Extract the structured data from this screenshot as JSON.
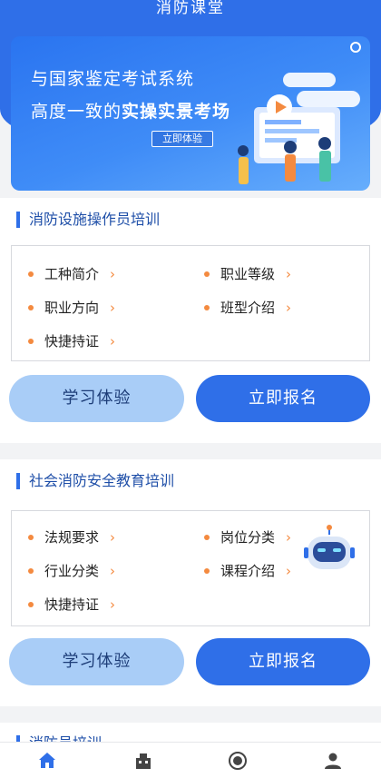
{
  "header": {
    "title": "消防课堂"
  },
  "banner": {
    "line1": "与国家鉴定考试系统",
    "line2_prefix": "高度一致的",
    "line2_bold": "实操实景考场",
    "cta": "立即体验"
  },
  "sections": [
    {
      "title": "消防设施操作员培训",
      "items": [
        {
          "label": "工种简介"
        },
        {
          "label": "职业等级"
        },
        {
          "label": "职业方向"
        },
        {
          "label": "班型介绍"
        },
        {
          "label": "快捷持证"
        }
      ],
      "btn_exp": "学习体验",
      "btn_reg": "立即报名"
    },
    {
      "title": "社会消防安全教育培训",
      "items": [
        {
          "label": "法规要求"
        },
        {
          "label": "岗位分类"
        },
        {
          "label": "行业分类"
        },
        {
          "label": "课程介绍"
        },
        {
          "label": "快捷持证"
        }
      ],
      "btn_exp": "学习体验",
      "btn_reg": "立即报名"
    },
    {
      "title": "消防员培训"
    }
  ],
  "tabbar": [
    {
      "icon": "home-icon"
    },
    {
      "icon": "building-icon"
    },
    {
      "icon": "coin-icon"
    },
    {
      "icon": "user-icon"
    }
  ],
  "colors": {
    "primary": "#2f6fe8",
    "light_button": "#a9cdf7",
    "bullet": "#f48a3f"
  },
  "chevron": "›"
}
